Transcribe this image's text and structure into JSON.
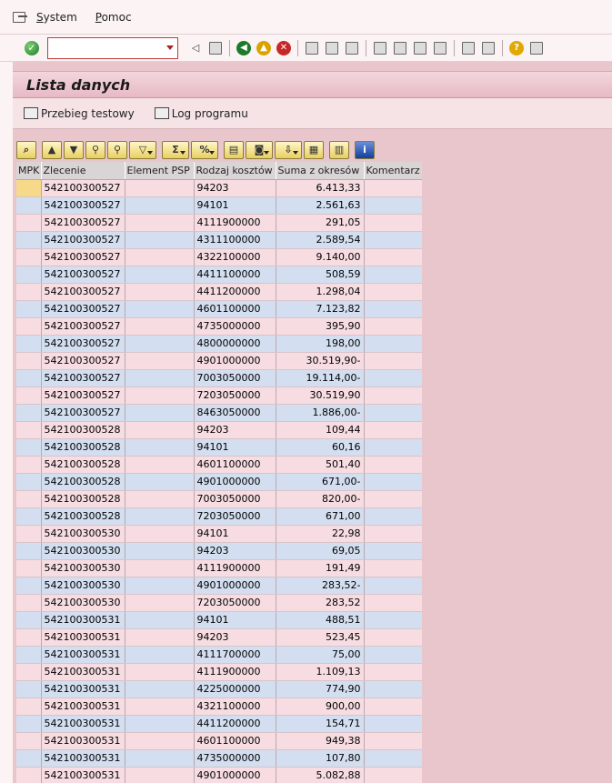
{
  "menu": {
    "system_prefix": "S",
    "system_rest": "ystem",
    "pomoc_prefix": "P",
    "pomoc_rest": "omoc"
  },
  "toolbar": {
    "command_value": ""
  },
  "title": "Lista danych",
  "app_toolbar": {
    "test_run_label": "Przebieg testowy",
    "log_label": "Log programu"
  },
  "columns": {
    "mpk": "MPK",
    "zlecenie": "Zlecenie",
    "element_psp": "Element PSP",
    "rodzaj_kosztow": "Rodzaj kosztów",
    "suma": "Suma z okresów",
    "komentarz": "Komentarz"
  },
  "rows": [
    {
      "zlecenie": "542100300527",
      "rodzaj": "94203",
      "suma": "6.413,33"
    },
    {
      "zlecenie": "542100300527",
      "rodzaj": "94101",
      "suma": "2.561,63"
    },
    {
      "zlecenie": "542100300527",
      "rodzaj": "4111900000",
      "suma": "291,05"
    },
    {
      "zlecenie": "542100300527",
      "rodzaj": "4311100000",
      "suma": "2.589,54"
    },
    {
      "zlecenie": "542100300527",
      "rodzaj": "4322100000",
      "suma": "9.140,00"
    },
    {
      "zlecenie": "542100300527",
      "rodzaj": "4411100000",
      "suma": "508,59"
    },
    {
      "zlecenie": "542100300527",
      "rodzaj": "4411200000",
      "suma": "1.298,04"
    },
    {
      "zlecenie": "542100300527",
      "rodzaj": "4601100000",
      "suma": "7.123,82"
    },
    {
      "zlecenie": "542100300527",
      "rodzaj": "4735000000",
      "suma": "395,90"
    },
    {
      "zlecenie": "542100300527",
      "rodzaj": "4800000000",
      "suma": "198,00"
    },
    {
      "zlecenie": "542100300527",
      "rodzaj": "4901000000",
      "suma": "30.519,90-"
    },
    {
      "zlecenie": "542100300527",
      "rodzaj": "7003050000",
      "suma": "19.114,00-"
    },
    {
      "zlecenie": "542100300527",
      "rodzaj": "7203050000",
      "suma": "30.519,90"
    },
    {
      "zlecenie": "542100300527",
      "rodzaj": "8463050000",
      "suma": "1.886,00-"
    },
    {
      "zlecenie": "542100300528",
      "rodzaj": "94203",
      "suma": "109,44"
    },
    {
      "zlecenie": "542100300528",
      "rodzaj": "94101",
      "suma": "60,16"
    },
    {
      "zlecenie": "542100300528",
      "rodzaj": "4601100000",
      "suma": "501,40"
    },
    {
      "zlecenie": "542100300528",
      "rodzaj": "4901000000",
      "suma": "671,00-"
    },
    {
      "zlecenie": "542100300528",
      "rodzaj": "7003050000",
      "suma": "820,00-"
    },
    {
      "zlecenie": "542100300528",
      "rodzaj": "7203050000",
      "suma": "671,00"
    },
    {
      "zlecenie": "542100300530",
      "rodzaj": "94101",
      "suma": "22,98"
    },
    {
      "zlecenie": "542100300530",
      "rodzaj": "94203",
      "suma": "69,05"
    },
    {
      "zlecenie": "542100300530",
      "rodzaj": "4111900000",
      "suma": "191,49"
    },
    {
      "zlecenie": "542100300530",
      "rodzaj": "4901000000",
      "suma": "283,52-"
    },
    {
      "zlecenie": "542100300530",
      "rodzaj": "7203050000",
      "suma": "283,52"
    },
    {
      "zlecenie": "542100300531",
      "rodzaj": "94101",
      "suma": "488,51"
    },
    {
      "zlecenie": "542100300531",
      "rodzaj": "94203",
      "suma": "523,45"
    },
    {
      "zlecenie": "542100300531",
      "rodzaj": "4111700000",
      "suma": "75,00"
    },
    {
      "zlecenie": "542100300531",
      "rodzaj": "4111900000",
      "suma": "1.109,13"
    },
    {
      "zlecenie": "542100300531",
      "rodzaj": "4225000000",
      "suma": "774,90"
    },
    {
      "zlecenie": "542100300531",
      "rodzaj": "4321100000",
      "suma": "900,00"
    },
    {
      "zlecenie": "542100300531",
      "rodzaj": "4411200000",
      "suma": "154,71"
    },
    {
      "zlecenie": "542100300531",
      "rodzaj": "4601100000",
      "suma": "949,38"
    },
    {
      "zlecenie": "542100300531",
      "rodzaj": "4735000000",
      "suma": "107,80"
    },
    {
      "zlecenie": "542100300531",
      "rodzaj": "4901000000",
      "suma": "5.082,88"
    }
  ]
}
